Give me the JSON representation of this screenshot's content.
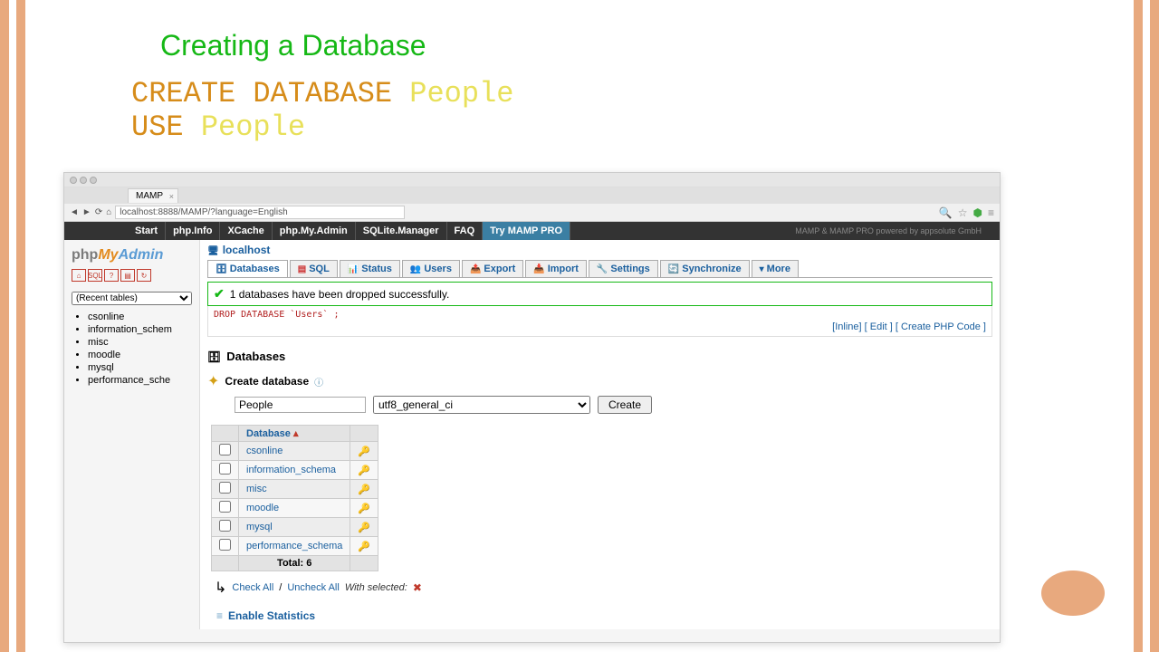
{
  "slide": {
    "title": "Creating a Database",
    "sql_kw1": "CREATE DATABASE",
    "sql_id1": "People",
    "sql_kw2": "USE",
    "sql_id2": "People"
  },
  "browser": {
    "tab_title": "MAMP",
    "url": "localhost:8888/MAMP/?language=English"
  },
  "mamp_nav": {
    "items": [
      "Start",
      "php.Info",
      "XCache",
      "php.My.Admin",
      "SQLite.Manager",
      "FAQ"
    ],
    "try": "Try MAMP PRO",
    "footer": "MAMP & MAMP PRO powered by appsolute GmbH"
  },
  "pma": {
    "logo_php": "php",
    "logo_my": "My",
    "logo_admin": "Admin",
    "recent_label": "(Recent tables)",
    "recent_dbs": [
      "csonline",
      "information_schem",
      "misc",
      "moodle",
      "mysql",
      "performance_sche"
    ],
    "host": "localhost",
    "tabs": [
      "Databases",
      "SQL",
      "Status",
      "Users",
      "Export",
      "Import",
      "Settings",
      "Synchronize"
    ],
    "more": "More",
    "success_msg": "1 databases have been dropped successfully.",
    "sql_echo": "DROP DATABASE `Users` ;",
    "links": {
      "inline": "Inline",
      "edit": "Edit",
      "create_php": "Create PHP Code"
    },
    "db_heading": "Databases",
    "create_label": "Create database",
    "create_name": "People",
    "create_collation": "utf8_general_ci",
    "create_btn": "Create",
    "table": {
      "header": "Database",
      "rows": [
        "csonline",
        "information_schema",
        "misc",
        "moodle",
        "mysql",
        "performance_schema"
      ],
      "total_label": "Total: 6"
    },
    "check_all": "Check All",
    "uncheck_all": "Uncheck All",
    "with_selected": "With selected:",
    "enable_stats": "Enable Statistics"
  }
}
